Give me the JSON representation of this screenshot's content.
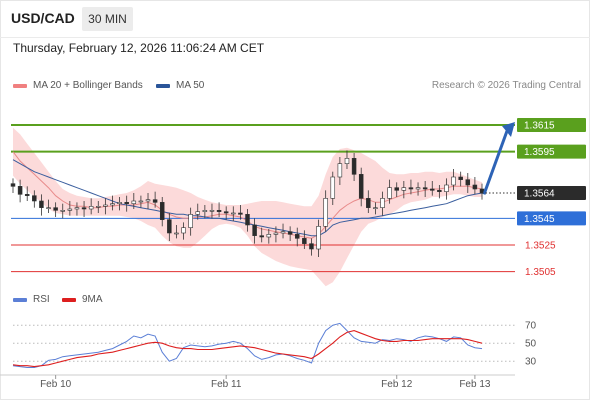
{
  "header": {
    "symbol": "USD/CAD",
    "timeframe": "30 MIN"
  },
  "timestamp": "Thursday, February 12, 2026 11:06:24 AM CET",
  "credit": "Research © 2026 Trading Central",
  "legend": {
    "ma20": {
      "label": "MA 20 + Bollinger Bands",
      "color": "#f08080"
    },
    "ma50": {
      "label": "MA 50",
      "color": "#2a5599"
    }
  },
  "rsi_legend": {
    "rsi": {
      "label": "RSI",
      "color": "#5b7fd6"
    },
    "ma9": {
      "label": "9MA",
      "color": "#dd1f1f"
    }
  },
  "chart_data": {
    "type": "candlestick",
    "price_axis": {
      "range": [
        1.3495,
        1.363
      ]
    },
    "current_price": {
      "label": "1.3564",
      "value": 1.3564,
      "color": "#2b2b2b"
    },
    "levels": [
      {
        "label": "1.3615",
        "value": 1.3615,
        "kind": "resistance",
        "color": "#5aa01e"
      },
      {
        "label": "1.3595",
        "value": 1.3595,
        "kind": "resistance",
        "color": "#5aa01e"
      },
      {
        "label": "1.3545",
        "value": 1.3545,
        "kind": "pivot",
        "color": "#2e6fd8"
      },
      {
        "label": "1.3525",
        "value": 1.3525,
        "kind": "support",
        "color": "#e03030"
      },
      {
        "label": "1.3505",
        "value": 1.3505,
        "kind": "support",
        "color": "#e03030"
      }
    ],
    "forecast_arrow": {
      "from": 1.3563,
      "to": 1.3615,
      "direction": "up",
      "color": "#2d63b6"
    },
    "x_ticks": [
      "Feb 10",
      "Feb 11",
      "Feb 12",
      "Feb 13"
    ],
    "x_tick_index": [
      6.0,
      30.0,
      54.0,
      65.0
    ],
    "close": [
      1.3569,
      1.3563,
      1.3562,
      1.3558,
      1.3553,
      1.3553,
      1.3551,
      1.3551,
      1.3552,
      1.3553,
      1.3552,
      1.3554,
      1.3554,
      1.3555,
      1.3556,
      1.3557,
      1.3556,
      1.3558,
      1.3558,
      1.3559,
      1.3557,
      1.3544,
      1.3534,
      1.3534,
      1.3538,
      1.3548,
      1.355,
      1.3551,
      1.3551,
      1.355,
      1.3549,
      1.3549,
      1.3548,
      1.354,
      1.3532,
      1.3531,
      1.3533,
      1.3534,
      1.3535,
      1.3533,
      1.353,
      1.3526,
      1.3522,
      1.3539,
      1.356,
      1.3576,
      1.3586,
      1.359,
      1.3578,
      1.356,
      1.3553,
      1.3553,
      1.356,
      1.3568,
      1.3566,
      1.3568,
      1.3567,
      1.3568,
      1.3567,
      1.3566,
      1.3565,
      1.357,
      1.3576,
      1.3574,
      1.357,
      1.3567,
      1.3564
    ],
    "ma20": [
      1.3595,
      1.3588,
      1.3583,
      1.3578,
      1.3573,
      1.3568,
      1.3562,
      1.3558,
      1.3555,
      1.3554,
      1.3554,
      1.3553,
      1.3553,
      1.3554,
      1.3554,
      1.3555,
      1.3555,
      1.3555,
      1.3556,
      1.3557,
      1.3555,
      1.3551,
      1.3548,
      1.3546,
      1.3545,
      1.3545,
      1.3546,
      1.3546,
      1.3547,
      1.3548,
      1.3548,
      1.3547,
      1.3546,
      1.3543,
      1.3539,
      1.3537,
      1.3536,
      1.3535,
      1.3534,
      1.3533,
      1.3532,
      1.3531,
      1.353,
      1.3533,
      1.3539,
      1.3545,
      1.3551,
      1.3555,
      1.3558,
      1.356,
      1.3559,
      1.3557,
      1.3557,
      1.3559,
      1.3561,
      1.3563,
      1.3564,
      1.3565,
      1.3566,
      1.3567,
      1.3567,
      1.3568,
      1.3569,
      1.3569,
      1.3569,
      1.3568,
      1.3567
    ],
    "bb_upper": [
      1.3613,
      1.3608,
      1.3601,
      1.3594,
      1.3587,
      1.358,
      1.3573,
      1.3567,
      1.3564,
      1.3562,
      1.3561,
      1.356,
      1.356,
      1.3561,
      1.3562,
      1.3563,
      1.3564,
      1.3566,
      1.3569,
      1.3573,
      1.3571,
      1.357,
      1.3569,
      1.3568,
      1.3566,
      1.3564,
      1.3561,
      1.3559,
      1.3557,
      1.3556,
      1.3555,
      1.3555,
      1.3555,
      1.3556,
      1.3557,
      1.3558,
      1.3558,
      1.3558,
      1.3557,
      1.3556,
      1.3555,
      1.3554,
      1.3554,
      1.3562,
      1.3578,
      1.3591,
      1.3597,
      1.3598,
      1.3596,
      1.3594,
      1.3591,
      1.3588,
      1.3583,
      1.3579,
      1.3578,
      1.3578,
      1.3579,
      1.3579,
      1.358,
      1.358,
      1.3579,
      1.358,
      1.358,
      1.3578,
      1.3576,
      1.3574,
      1.3572
    ],
    "bb_lower": [
      1.3577,
      1.3571,
      1.3566,
      1.3561,
      1.3557,
      1.3552,
      1.3549,
      1.3548,
      1.3547,
      1.3547,
      1.3547,
      1.3547,
      1.3547,
      1.3547,
      1.3547,
      1.3547,
      1.3546,
      1.3545,
      1.3543,
      1.354,
      1.3538,
      1.3532,
      1.3527,
      1.3524,
      1.3523,
      1.3523,
      1.3527,
      1.3532,
      1.3537,
      1.354,
      1.3541,
      1.354,
      1.3538,
      1.3532,
      1.3524,
      1.3519,
      1.3516,
      1.3513,
      1.3511,
      1.3509,
      1.3508,
      1.3507,
      1.3506,
      1.35,
      1.3494,
      1.3497,
      1.3505,
      1.3515,
      1.3525,
      1.3535,
      1.3541,
      1.3543,
      1.3546,
      1.3548,
      1.3551,
      1.3555,
      1.3557,
      1.3558,
      1.3559,
      1.3561,
      1.3561,
      1.3562,
      1.3563,
      1.3563,
      1.3562,
      1.3561,
      1.3561
    ],
    "ma50": [
      1.3589,
      1.3586,
      1.3583,
      1.358,
      1.3578,
      1.3576,
      1.3574,
      1.3572,
      1.357,
      1.3568,
      1.3566,
      1.3564,
      1.3562,
      1.356,
      1.3558,
      1.3556,
      1.3555,
      1.3554,
      1.3553,
      1.3552,
      1.3551,
      1.355,
      1.3549,
      1.3548,
      1.3548,
      1.3547,
      1.3547,
      1.3546,
      1.3545,
      1.3545,
      1.3544,
      1.3543,
      1.3542,
      1.3541,
      1.354,
      1.3539,
      1.3538,
      1.3537,
      1.3536,
      1.3535,
      1.3534,
      1.3533,
      1.3532,
      1.3532,
      1.3535,
      1.354,
      1.3542,
      1.3543,
      1.3544,
      1.3545,
      1.3545,
      1.3546,
      1.3547,
      1.3548,
      1.3549,
      1.355,
      1.3551,
      1.3552,
      1.3553,
      1.3554,
      1.3555,
      1.3556,
      1.3558,
      1.356,
      1.3562,
      1.3563,
      1.3564
    ],
    "rsi": {
      "ticks": [
        70,
        50,
        30
      ],
      "range": [
        18,
        78
      ],
      "rsi": [
        25,
        24,
        23,
        23,
        25,
        31,
        32,
        35,
        36,
        37,
        38,
        39,
        40,
        42,
        44,
        48,
        52,
        58,
        56,
        60,
        58,
        40,
        30,
        33,
        45,
        48,
        47,
        46,
        47,
        49,
        50,
        52,
        50,
        44,
        36,
        32,
        34,
        37,
        38,
        36,
        33,
        31,
        28,
        50,
        64,
        70,
        72,
        64,
        56,
        52,
        51,
        50,
        54,
        53,
        55,
        54,
        52,
        56,
        58,
        57,
        55,
        52,
        57,
        56,
        48,
        45,
        44
      ],
      "ma9": [
        26,
        25,
        25,
        24,
        25,
        26,
        28,
        30,
        32,
        34,
        35,
        36,
        38,
        39,
        40,
        42,
        44,
        46,
        48,
        50,
        51,
        50,
        47,
        45,
        44,
        44,
        43,
        43,
        43,
        44,
        45,
        46,
        47,
        46,
        45,
        43,
        41,
        39,
        38,
        37,
        36,
        35,
        33,
        38,
        44,
        50,
        57,
        62,
        64,
        61,
        58,
        55,
        53,
        52,
        52,
        53,
        53,
        53,
        54,
        55,
        55,
        55,
        55,
        55,
        54,
        52,
        50
      ]
    }
  }
}
